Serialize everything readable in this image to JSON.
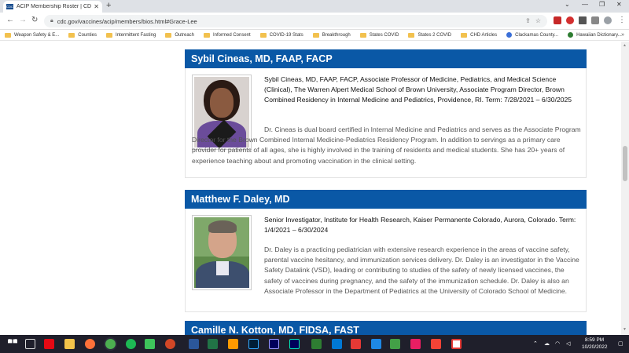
{
  "browser": {
    "tab_title": "ACIP Membership Roster | CDC",
    "tab_close": "✕",
    "new_tab": "+",
    "url": "cdc.gov/vaccines/acip/members/bios.html#Grace-Lee",
    "favicon_text": "CDC"
  },
  "bookmarks": [
    {
      "label": "Weapon Safety & E...",
      "type": "folder"
    },
    {
      "label": "Counties",
      "type": "folder"
    },
    {
      "label": "Intermittent Fasting",
      "type": "folder"
    },
    {
      "label": "Outreach",
      "type": "folder"
    },
    {
      "label": "Informed Consent",
      "type": "folder"
    },
    {
      "label": "COVID-19 Stats",
      "type": "folder"
    },
    {
      "label": "Breakthrough",
      "type": "folder"
    },
    {
      "label": "States COVID",
      "type": "folder"
    },
    {
      "label": "States 2 COVID",
      "type": "folder"
    },
    {
      "label": "CHD Articles",
      "type": "folder"
    },
    {
      "label": "Clackamas County...",
      "type": "site"
    },
    {
      "label": "Hawaiian Dictionary...",
      "type": "site"
    }
  ],
  "members": [
    {
      "name": "Sybil Cineas, MD, FAAP, FACP",
      "summary": "Sybil Cineas, MD, FAAP, FACP, Associate Professor of Medicine, Pediatrics, and Medical Science (Clinical), The Warren Alpert Medical School of Brown University, Associate Program Director, Brown Combined Residency in Internal Medicine and Pediatrics, Providence, RI. Term: 7/28/2021 – 6/30/2025",
      "detail": "Dr. Cineas is dual board certified in Internal Medicine and Pediatrics and serves as the Associate Program Director for the Brown Combined Internal Medicine-Pediatrics Residency Program. In addition to servings as a primary care provider for patients of all ages, she is highly involved in the training of residents and medical students. She has 20+ years of experience teaching about and promoting vaccination in the clinical setting."
    },
    {
      "name": "Matthew F. Daley, MD",
      "summary": "Senior Investigator, Institute for Health Research, Kaiser Permanente Colorado, Aurora, Colorado. Term: 1/4/2021 – 6/30/2024",
      "detail": "Dr. Daley is a practicing pediatrician with extensive research experience in the areas of vaccine safety, parental vaccine hesitancy, and immunization services delivery.  Dr. Daley is an investigator in the Vaccine Safety Datalink (VSD), leading or contributing to studies of the safety of newly licensed vaccines, the safety of vaccines during pregnancy, and the safety of the immunization schedule. Dr. Daley is also an Associate Professor in the Department of Pediatrics at the University of Colorado School of Medicine."
    },
    {
      "name": "Camille N. Kotton, MD, FIDSA, FAST"
    }
  ],
  "taskbar": {
    "time": "8:59 PM",
    "date": "10/20/2022"
  },
  "colors": {
    "header_blue": "#0a58a6",
    "taskbar": "#1f1f2b"
  }
}
